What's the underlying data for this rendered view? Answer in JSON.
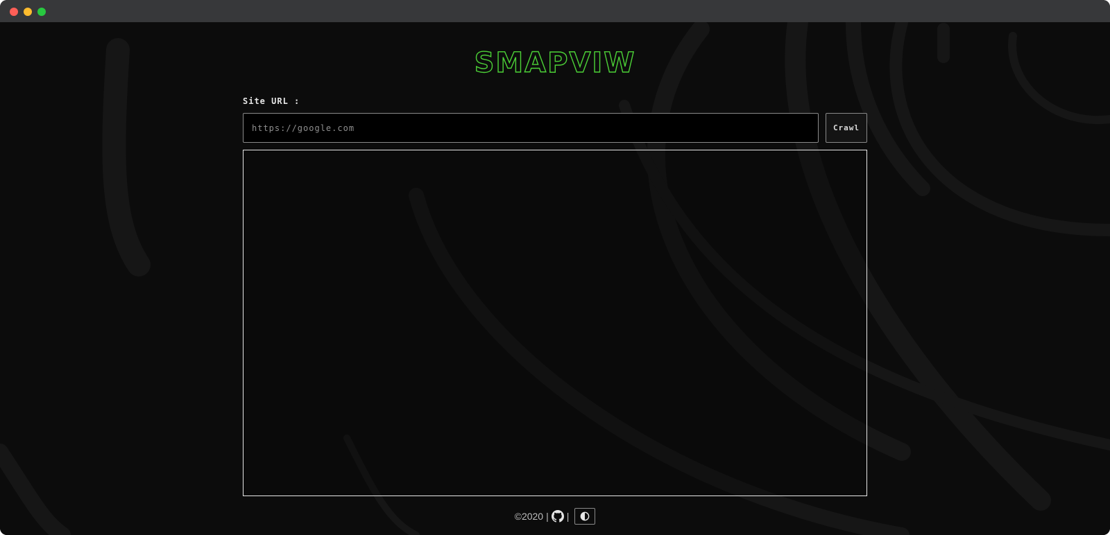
{
  "window": {
    "controls": [
      "close",
      "minimize",
      "zoom"
    ]
  },
  "app": {
    "logo_text": "SMAPVIW",
    "accent_color": "#4cd137"
  },
  "form": {
    "site_label": "Site URL :",
    "url_placeholder": "https://google.com",
    "url_value": "",
    "crawl_label": "Crawl"
  },
  "output": {
    "content": ""
  },
  "footer": {
    "copyright": "©2020",
    "separator": "|",
    "github_icon": "github-icon",
    "theme_icon": "contrast-icon"
  }
}
